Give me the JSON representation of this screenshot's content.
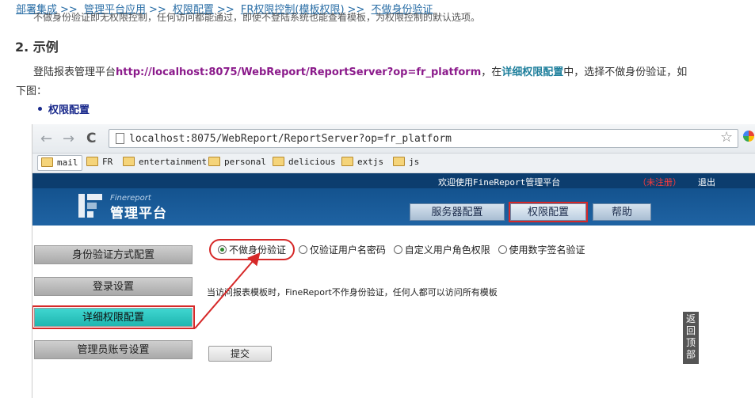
{
  "breadcrumb": {
    "items": [
      "部署集成",
      "管理平台应用",
      "权限配置",
      "FR权限控制(模板权限)",
      "不做身份验证"
    ],
    "separator": ">>"
  },
  "intro": "不做身份验证即无权限控制，任何访问都能通过，即使不登陆系统也能查看模板，为权限控制的默认选项。",
  "section": {
    "heading": "2. 示例"
  },
  "paragraph": {
    "prefix": "登陆报表管理平台",
    "url": "http://localhost:8075/WebReport/ReportServer?op=fr_platform",
    "middle": "，在",
    "highlight": "详细权限配置",
    "suffix": "中，选择不做身份验证，如下图："
  },
  "bullet": {
    "label": "权限配置"
  },
  "browser": {
    "back": "←",
    "forward": "→",
    "reload": "C",
    "address": "localhost:8075/WebReport/ReportServer?op=fr_platform",
    "star": "☆",
    "bookmarks": [
      "mail",
      "FR",
      "entertainment",
      "personal",
      "delicious",
      "extjs",
      "js"
    ]
  },
  "app": {
    "welcome": "欢迎使用FineReport管理平台",
    "unregistered": "（未注册）",
    "logout": "退出",
    "logo_small": "Finereport",
    "logo_big": "管理平台",
    "tabs": [
      "服务器配置",
      "权限配置",
      "帮助"
    ],
    "sidebar": [
      "身份验证方式配置",
      "登录设置",
      "详细权限配置",
      "管理员账号设置"
    ],
    "radios": [
      "不做身份验证",
      "仅验证用户名密码",
      "自定义用户角色权限",
      "使用数字签名验证"
    ],
    "description": "当访问报表模板时，FineReport不作身份验证，任何人都可以访问所有模板",
    "submit": "提交",
    "to_top": "返回顶部"
  },
  "colors": {
    "highlight_red": "#d62828",
    "active_cyan": "#1fb6b0",
    "header_blue": "#1f63a3",
    "link_purple": "#8b1a8b"
  }
}
